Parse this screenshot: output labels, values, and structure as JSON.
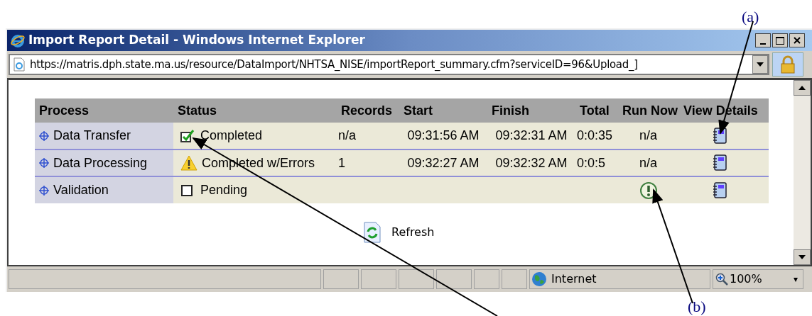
{
  "annotations": [
    {
      "label": "(a)"
    },
    {
      "label": "(b)"
    }
  ],
  "window": {
    "title": "Import Report Detail - Windows Internet Explorer",
    "address": "https://matris.dph.state.ma.us/resource/DataImport/NHTSA_NISE/importReport_summary.cfm?serviceID=96&Upload_]"
  },
  "table": {
    "columns": [
      "Process",
      "Status",
      "Records",
      "Start",
      "Finish",
      "Total",
      "Run Now",
      "View Details"
    ],
    "rows": [
      {
        "process": "Data Transfer",
        "status": {
          "kind": "completed",
          "label": "Completed"
        },
        "records": "n/a",
        "start": "09:31:56 AM",
        "finish": "09:32:31 AM",
        "total": "0:0:35",
        "run_now": {
          "kind": "text",
          "text": "n/a"
        }
      },
      {
        "process": "Data Processing",
        "status": {
          "kind": "warning",
          "label": "Completed w/Errors"
        },
        "records": "1",
        "start": "09:32:27 AM",
        "finish": "09:32:32 AM",
        "total": "0:0:5",
        "run_now": {
          "kind": "text",
          "text": "n/a"
        }
      },
      {
        "process": "Validation",
        "status": {
          "kind": "pending",
          "label": "Pending"
        },
        "records": "",
        "start": "",
        "finish": "",
        "total": "",
        "run_now": {
          "kind": "icon"
        }
      }
    ]
  },
  "refresh_button": "Refresh",
  "status_bar": {
    "zone": "Internet",
    "zoom": "100%",
    "zoom_caret": "▾"
  }
}
